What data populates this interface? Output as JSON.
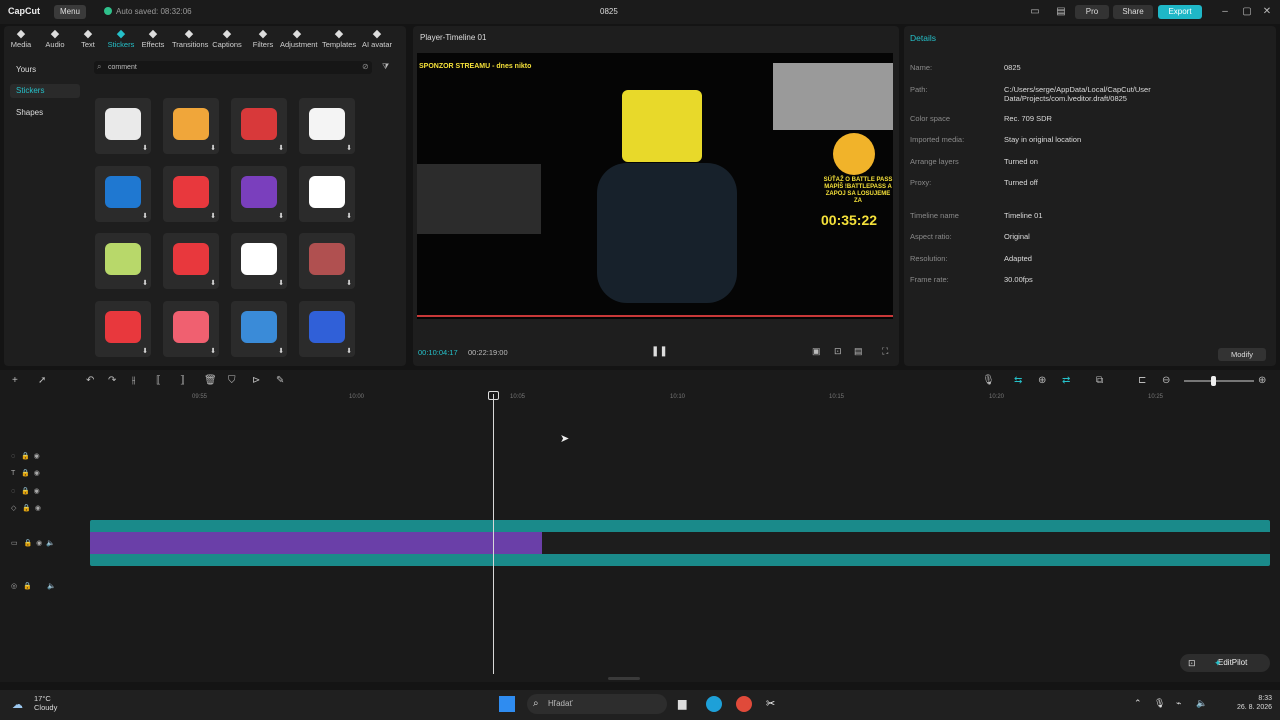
{
  "app": {
    "name": "CapCut",
    "menu_label": "Menu",
    "autosave": "Auto saved: 08:32:06",
    "project_title": "0825",
    "pro_label": "Pro",
    "share_label": "Share",
    "export_label": "Export"
  },
  "tools": [
    {
      "label": "Media",
      "icon": "media-icon"
    },
    {
      "label": "Audio",
      "icon": "audio-icon"
    },
    {
      "label": "Text",
      "icon": "text-icon"
    },
    {
      "label": "Stickers",
      "icon": "stickers-icon"
    },
    {
      "label": "Effects",
      "icon": "effects-icon"
    },
    {
      "label": "Transitions",
      "icon": "transitions-icon"
    },
    {
      "label": "Captions",
      "icon": "captions-icon"
    },
    {
      "label": "Filters",
      "icon": "filters-icon"
    },
    {
      "label": "Adjustment",
      "icon": "adjustment-icon"
    },
    {
      "label": "Templates",
      "icon": "templates-icon"
    },
    {
      "label": "AI avatar",
      "icon": "ai-avatar-icon"
    }
  ],
  "sidebar": {
    "items": [
      {
        "label": "Yours"
      },
      {
        "label": "Stickers"
      },
      {
        "label": "Shapes"
      }
    ]
  },
  "search": {
    "value": "comment"
  },
  "stickers": [
    {
      "color": "#eaeaea"
    },
    {
      "color": "#f0a63a"
    },
    {
      "color": "#d8393a"
    },
    {
      "color": "#f4f4f4"
    },
    {
      "color": "#1f78d1"
    },
    {
      "color": "#e8383d"
    },
    {
      "color": "#7a3fbd"
    },
    {
      "color": "#ffffff"
    },
    {
      "color": "#b8d86a"
    },
    {
      "color": "#e8383d"
    },
    {
      "color": "#ffffff"
    },
    {
      "color": "#b05050"
    },
    {
      "color": "#e8383d"
    },
    {
      "color": "#f06070"
    },
    {
      "color": "#3a8bd8"
    },
    {
      "color": "#3060d8"
    }
  ],
  "player": {
    "title": "Player-Timeline 01",
    "current_time": "00:10:04:17",
    "total_time": "00:22:19:00",
    "overlay_text": "SPONZOR STREAMU - dnes nikto",
    "timer": "00:35:22",
    "battlepass": "SÚŤAŽ O BATTLE PASS MAPÍŠ !BATTLEPASS A ZAPOJ SA LOSUJEME ZA"
  },
  "details": {
    "heading": "Details",
    "modify_label": "Modify",
    "rows": [
      {
        "label": "Name:",
        "value": "0825"
      },
      {
        "label": "Path:",
        "value": "C:/Users/serge/AppData/Local/CapCut/User Data/Projects/com.lveditor.draft/0825"
      },
      {
        "label": "Color space",
        "value": "Rec. 709 SDR"
      },
      {
        "label": "Imported media:",
        "value": "Stay in original location"
      },
      {
        "label": "Arrange layers",
        "value": "Turned on"
      },
      {
        "label": "Proxy:",
        "value": "Turned off"
      },
      {
        "label": "Timeline name",
        "value": "Timeline 01"
      },
      {
        "label": "Aspect ratio:",
        "value": "Original"
      },
      {
        "label": "Resolution:",
        "value": "Adapted"
      },
      {
        "label": "Frame rate:",
        "value": "30.00fps"
      }
    ]
  },
  "timeline": {
    "ticks": [
      "09:55",
      "10:00",
      "10:05",
      "10:10",
      "10:15",
      "10:20",
      "10:25"
    ],
    "editpilot_label": "EditPilot"
  },
  "taskbar": {
    "temperature": "17°C",
    "weather": "Cloudy",
    "search_placeholder": "Hľadať",
    "time": "8:33",
    "date": "26. 8. 2026"
  }
}
